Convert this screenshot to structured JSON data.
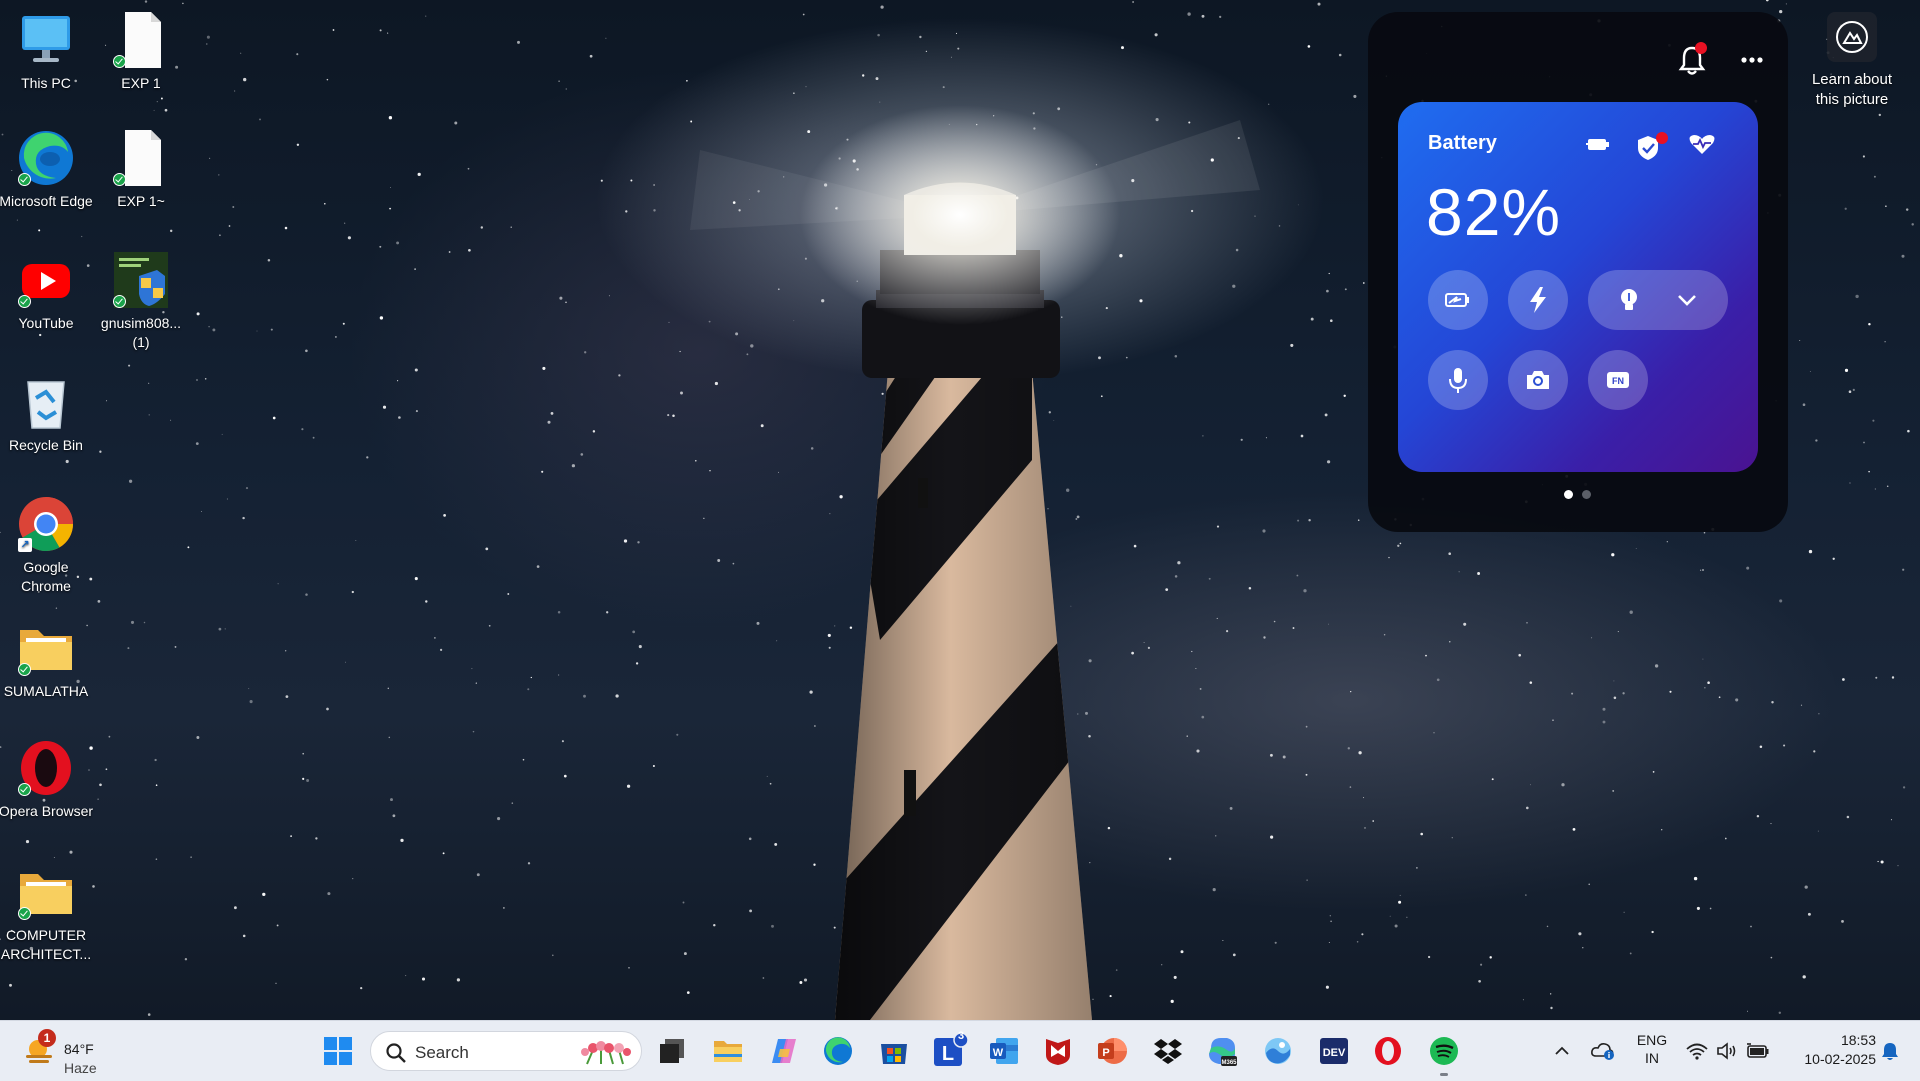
{
  "desktop": {
    "icons": [
      {
        "label": "This PC",
        "icon": "monitor-icon"
      },
      {
        "label": "EXP 1",
        "icon": "document-icon"
      },
      {
        "label": "Microsoft Edge",
        "icon": "edge-icon"
      },
      {
        "label": "EXP 1~",
        "icon": "document-icon"
      },
      {
        "label": "YouTube",
        "icon": "youtube-icon"
      },
      {
        "label": "gnusim808... (1)",
        "icon": "installer-icon"
      },
      {
        "label": "Recycle Bin",
        "icon": "recycle-bin-icon"
      },
      {
        "label": "Google Chrome",
        "icon": "chrome-icon"
      },
      {
        "label": "SUMALATHA",
        "icon": "folder-icon"
      },
      {
        "label": "Opera Browser",
        "icon": "opera-icon"
      },
      {
        "label": "COMPUTER ARCHITECT...",
        "icon": "folder-icon"
      }
    ]
  },
  "widget": {
    "battery": {
      "title": "Battery",
      "percent": "82%",
      "header_icons": [
        "plug-battery-icon",
        "shield-check-icon",
        "heart-pulse-icon"
      ],
      "controls_row1": [
        "battery-saver-icon",
        "lightning-icon",
        "lightbulb-icon",
        "chevron-down-icon"
      ],
      "controls_row2": [
        "microphone-icon",
        "camera-icon",
        "fn-key-icon"
      ]
    },
    "pager": {
      "count": 2,
      "active": 1
    },
    "colors": {
      "card_start": "#1f6df0",
      "card_end": "#4a1391",
      "notification_badge": "#e81123"
    }
  },
  "learn_picture": {
    "label": "Learn about this picture",
    "icon": "camera-aperture-icon"
  },
  "taskbar": {
    "weather": {
      "temp": "84°F",
      "condition": "Haze",
      "badge": "1"
    },
    "search": {
      "placeholder": "Search"
    },
    "apps": [
      "windows-start-icon",
      "task-view-icon",
      "file-explorer-icon",
      "copilot-icon",
      "edge-icon",
      "microsoft-store-icon",
      "lens-app-icon",
      "word-icon",
      "mcafee-icon",
      "powerpoint-icon",
      "dropbox-icon",
      "m365-icon",
      "photos-icon",
      "dev-icon",
      "opera-icon",
      "spotify-icon"
    ],
    "lens_badge": "3",
    "tray": {
      "lang_line1": "ENG",
      "lang_line2": "IN",
      "time": "18:53",
      "date": "10-02-2025"
    }
  }
}
